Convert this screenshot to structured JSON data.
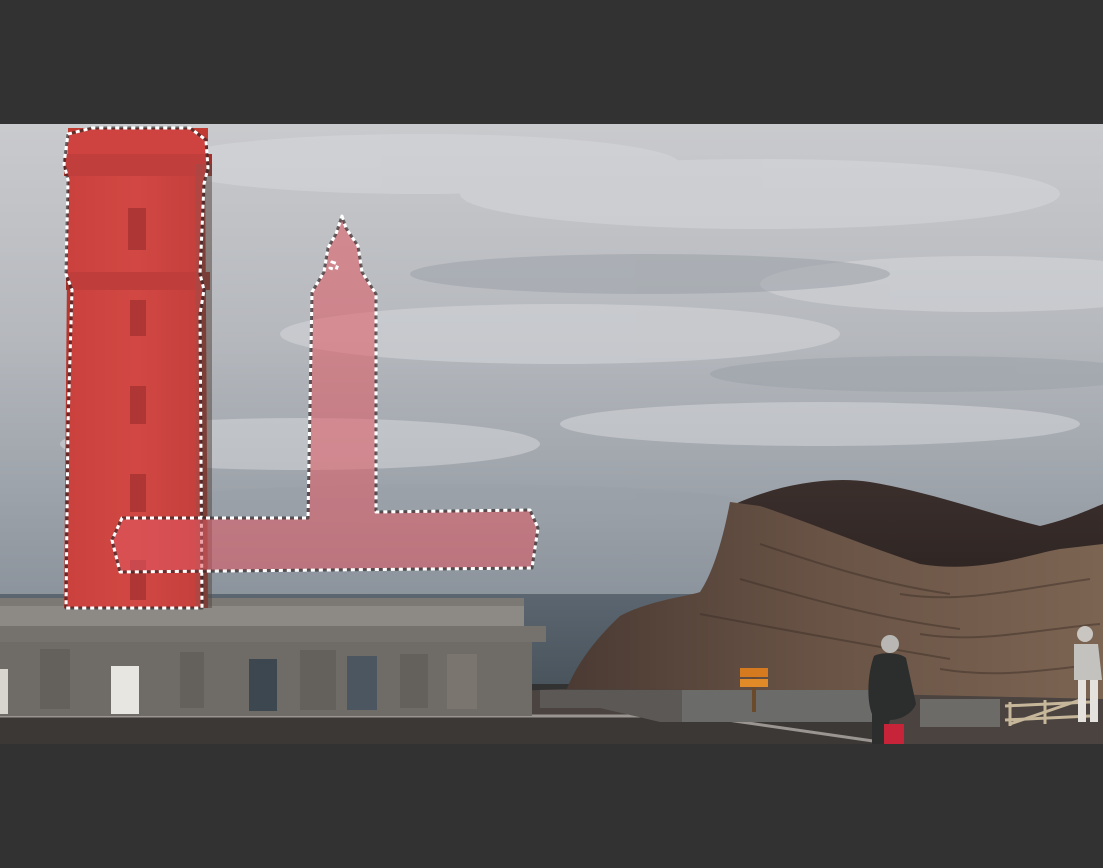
{
  "viewer": {
    "background_color": "#323232",
    "frame_content": "video-frame",
    "selection_overlay_color": "#d94a4a",
    "selection_outline": "marching-ants"
  },
  "selections": [
    {
      "id": "lighthouse-mask"
    },
    {
      "id": "drawn-t-mask"
    }
  ],
  "sign": {
    "text_color": "#7a2a1a"
  }
}
